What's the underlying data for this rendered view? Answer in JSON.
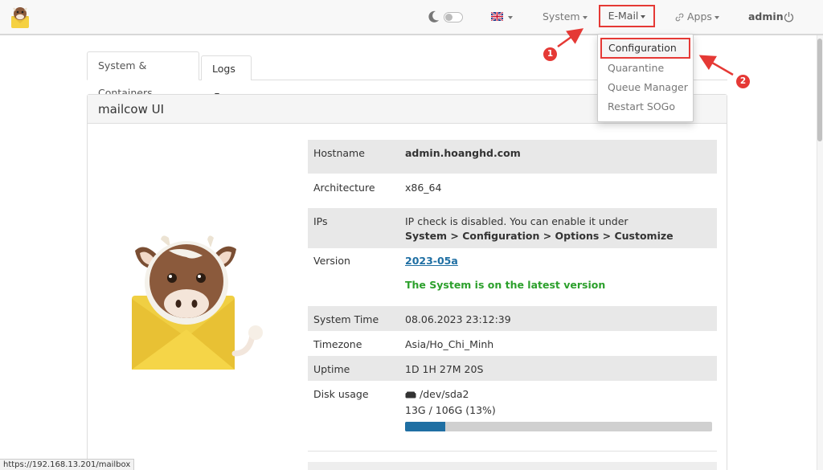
{
  "navbar": {
    "system_label": "System",
    "email_label": "E-Mail",
    "apps_label": "Apps",
    "user_label": "admin"
  },
  "email_menu": {
    "items": [
      "Configuration",
      "Quarantine",
      "Queue Manager",
      "Restart SOGo"
    ]
  },
  "tabs": {
    "system_containers": "System & Containers",
    "logs": "Logs"
  },
  "panel": {
    "title": "mailcow UI"
  },
  "info": {
    "hostname_label": "Hostname",
    "hostname_value": "admin.hoanghd.com",
    "architecture_label": "Architecture",
    "architecture_value": "x86_64",
    "ips_label": "IPs",
    "ips_line1": "IP check is disabled. You can enable it under",
    "ips_line2": "System > Configuration > Options > Customize",
    "version_label": "Version",
    "version_value": "2023-05a",
    "version_status": "The System is on the latest version",
    "system_time_label": "System Time",
    "system_time_value": "08.06.2023 23:12:39",
    "timezone_label": "Timezone",
    "timezone_value": "Asia/Ho_Chi_Minh",
    "uptime_label": "Uptime",
    "uptime_value": "1D 1H 27M 20S",
    "disk_label": "Disk usage",
    "disk_device": "/dev/sda2",
    "disk_usage_text": "13G / 106G (13%)",
    "disk_usage_fraction": 0.13
  },
  "status_bar": {
    "url": "https://192.168.13.201/mailbox"
  },
  "annotations": {
    "step1": "1",
    "step2": "2"
  },
  "colors": {
    "highlight": "#e53935",
    "link": "#1f6fa3",
    "ok_green": "#2ca02c",
    "progress_fill": "#1f6fa3"
  },
  "icons": [
    "logo-icon",
    "moon-icon",
    "uk-flag-icon",
    "link-icon",
    "power-icon",
    "hdd-icon"
  ]
}
